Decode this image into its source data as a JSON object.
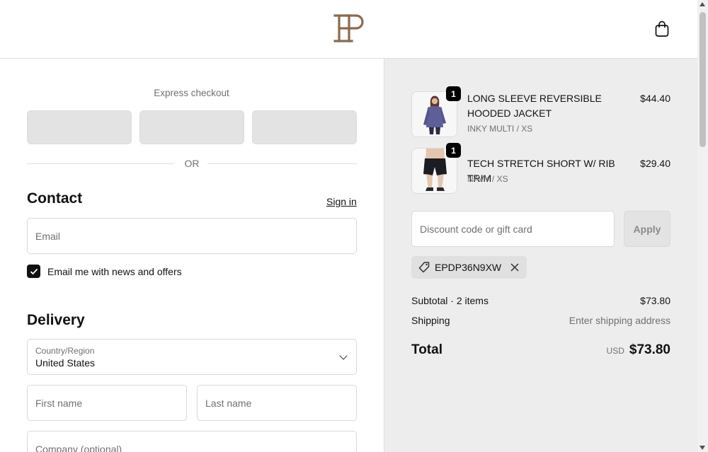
{
  "header": {
    "logo_icon": "ep-monogram-logo",
    "cart_icon": "shopping-bag-icon",
    "brand_color": "#8a6a4f"
  },
  "express": {
    "label": "Express checkout",
    "or_text": "OR"
  },
  "contact": {
    "heading": "Contact",
    "sign_in": "Sign in",
    "email_placeholder": "Email",
    "newsletter_label": "Email me with news and offers",
    "newsletter_checked": true
  },
  "delivery": {
    "heading": "Delivery",
    "country_label": "Country/Region",
    "country_value": "United States",
    "first_name_placeholder": "First name",
    "last_name_placeholder": "Last name",
    "company_placeholder": "Company (optional)"
  },
  "summary": {
    "items": [
      {
        "name": "LONG SLEEVE REVERSIBLE HOODED JACKET",
        "variant": "INKY MULTI / XS",
        "price": "$44.40",
        "quantity": "1"
      },
      {
        "name": "TECH STRETCH SHORT W/ RIB TRIM",
        "variant": "NAVY / XS",
        "price": "$29.40",
        "quantity": "1"
      }
    ],
    "discount_placeholder": "Discount code or gift card",
    "apply_label": "Apply",
    "discount_code": "EPDP36N9XW",
    "subtotal_label": "Subtotal · 2 items",
    "subtotal_value": "$73.80",
    "shipping_label": "Shipping",
    "shipping_value": "Enter shipping address",
    "total_label": "Total",
    "currency": "USD",
    "total_value": "$73.80"
  }
}
